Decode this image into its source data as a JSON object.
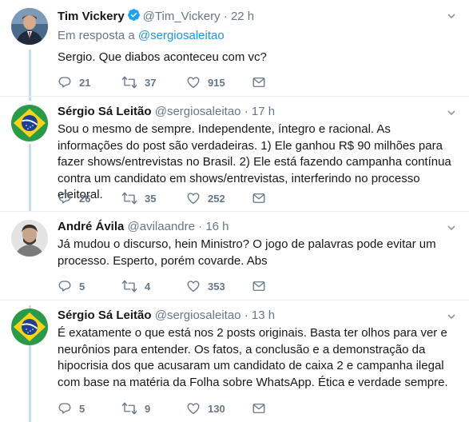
{
  "tweets": [
    {
      "name": "Tim Vickery",
      "verified": true,
      "handle": "@Tim_Vickery",
      "sep": "·",
      "time": "22 h",
      "reply_prefix": "Em resposta a ",
      "reply_mention": "@sergiosaleitao",
      "text": "Sergio. Que diabos aconteceu com vc?",
      "replies": "21",
      "retweets": "37",
      "likes": "915",
      "avatar": "tim-vickery-avatar"
    },
    {
      "name": "Sérgio Sá Leitão",
      "handle": "@sergiosaleitao",
      "sep": "·",
      "time": "17 h",
      "text": "Sou o mesmo de sempre. Independente, íntegro e racional. As informações do post são verdadeiras. 1) Ele ganhou R$ 90 milhões para fazer shows/entrevistas no Brasil. 2) Ele está fazendo campanha contínua contra um candidato em shows/entrevistas, interferindo no processo eleitoral.",
      "replies": "26",
      "retweets": "35",
      "likes": "252",
      "avatar": "brazil-flag-avatar"
    },
    {
      "name": "André Ávila",
      "handle": "@avilaandre",
      "sep": "·",
      "time": "16 h",
      "text": "Já mudou o discurso, hein Ministro? O jogo de palavras pode evitar um processo. Esperto, porém covarde. Abs",
      "replies": "5",
      "retweets": "4",
      "likes": "353",
      "avatar": "andre-avila-avatar"
    },
    {
      "name": "Sérgio Sá Leitão",
      "handle": "@sergiosaleitao",
      "sep": "·",
      "time": "13 h",
      "text": "É exatamente o que está nos 2 posts originais. Basta ter olhos para ver e neurônios para entender. Os fatos, a conclusão e a demonstração da hipocrisia dos que acusaram um candidato de caixa 2 e campanha ilegal com base na matéria da Folha sobre WhatsApp. Ética e verdade sempre.",
      "replies": "5",
      "retweets": "9",
      "likes": "130",
      "avatar": "brazil-flag-avatar"
    }
  ],
  "colors": {
    "text": "#14171a",
    "secondary": "#657786",
    "link": "#1b95e0",
    "verified": "#1da1f2",
    "thread_line": "#c4dcee",
    "separator": "#e6ecf0"
  }
}
